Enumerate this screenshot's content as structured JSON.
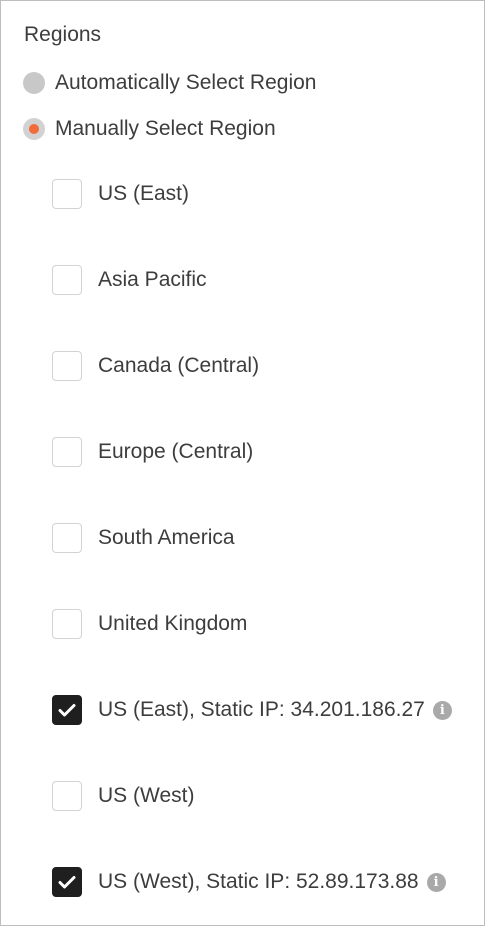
{
  "regions": {
    "title": "Regions",
    "mode_options": [
      {
        "label": "Automatically Select Region",
        "selected": false
      },
      {
        "label": "Manually Select Region",
        "selected": true
      }
    ],
    "items": [
      {
        "label": "US (East)",
        "checked": false,
        "info": false
      },
      {
        "label": "Asia Pacific",
        "checked": false,
        "info": false
      },
      {
        "label": "Canada (Central)",
        "checked": false,
        "info": false
      },
      {
        "label": "Europe (Central)",
        "checked": false,
        "info": false
      },
      {
        "label": "South America",
        "checked": false,
        "info": false
      },
      {
        "label": "United Kingdom",
        "checked": false,
        "info": false
      },
      {
        "label": "US (East), Static IP: 34.201.186.27",
        "checked": true,
        "info": true
      },
      {
        "label": "US (West)",
        "checked": false,
        "info": false
      },
      {
        "label": "US (West), Static IP: 52.89.173.88",
        "checked": true,
        "info": true
      }
    ]
  },
  "icons": {
    "info": "info-icon",
    "check": "checkmark-icon"
  },
  "colors": {
    "accent": "#f26b3a",
    "checked_box": "#1f1f1f",
    "radio_off": "#c8c8c8",
    "info_icon": "#a9a9a9",
    "text": "#3d3d3d",
    "border": "#bdbdbd"
  }
}
